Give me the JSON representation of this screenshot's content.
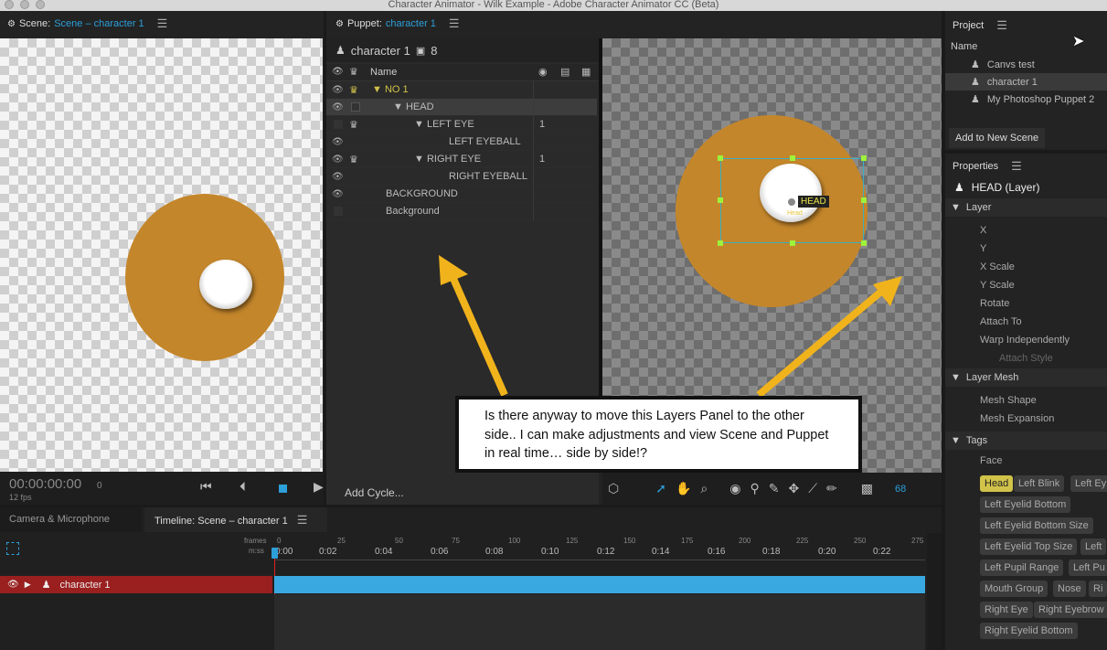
{
  "window_title": "Character Animator - Wilk Example - Adobe Character Animator CC (Beta)",
  "scene_panel": {
    "label": "Scene:",
    "name": "Scene – character 1",
    "timecode": "00:00:00:00",
    "frame": "0",
    "fps": "12 fps"
  },
  "puppet_panel": {
    "label": "Puppet:",
    "name": "character 1",
    "puppet_name": "character 1",
    "count": "8",
    "col_name": "Name",
    "add_cycle": "Add Cycle...",
    "zoom": "68"
  },
  "layers": [
    {
      "name": "NO 1",
      "num": ""
    },
    {
      "name": "HEAD",
      "num": ""
    },
    {
      "name": "LEFT EYE",
      "num": "1"
    },
    {
      "name": "LEFT EYEBALL",
      "num": ""
    },
    {
      "name": "RIGHT EYE",
      "num": "1"
    },
    {
      "name": "RIGHT EYEBALL",
      "num": ""
    },
    {
      "name": "BACKGROUND",
      "num": ""
    },
    {
      "name": "Background",
      "num": ""
    }
  ],
  "canvas_labels": {
    "head_handle": "HEAD",
    "head_small": "Head"
  },
  "callout": "Is there anyway to move this Layers Panel to the other side.. I can make adjustments and view Scene and Puppet in real time… side by side!?",
  "project": {
    "title": "Project",
    "col_name": "Name",
    "items": [
      "Canvs test",
      "character 1",
      "My Photoshop Puppet 2"
    ],
    "add_button": "Add to New Scene"
  },
  "properties": {
    "title": "Properties",
    "selected": "HEAD (Layer)",
    "layer_section": "Layer",
    "layer_props": [
      "X",
      "Y",
      "X Scale",
      "Y Scale",
      "Rotate",
      "Attach To",
      "Warp Independently"
    ],
    "attach_style": "Attach Style",
    "mesh_section": "Layer Mesh",
    "mesh_props": [
      "Mesh Shape",
      "Mesh Expansion"
    ],
    "tags_section": "Tags",
    "face": "Face",
    "tags": [
      "Head",
      "Left Blink",
      "Left Ey",
      "Left Eyelid Bottom",
      "Left Eyelid Bottom Size",
      "Left Eyelid Top Size",
      "Left",
      "Left Pupil Range",
      "Left Pu",
      "Mouth Group",
      "Nose",
      "Ri",
      "Right Eye",
      "Right Eyebrow",
      "Right Eyelid Bottom"
    ]
  },
  "timeline": {
    "tab_camera": "Camera & Microphone",
    "tab_timeline": "Timeline: Scene – character 1",
    "frames_label": "frames",
    "mss_label": "m:ss",
    "frame_ticks": [
      "0",
      "25",
      "50",
      "75",
      "100",
      "125",
      "150",
      "175",
      "200",
      "225",
      "250",
      "275"
    ],
    "time_ticks": [
      "0:00",
      "0:02",
      "0:04",
      "0:06",
      "0:08",
      "0:10",
      "0:12",
      "0:14",
      "0:16",
      "0:18",
      "0:20",
      "0:22"
    ],
    "track_name": "character 1"
  },
  "colors": {
    "accent": "#2d9fd9",
    "head_fill": "#c4862b",
    "track_bar": "#3aa8e0",
    "track_row": "#9a1f1f",
    "arrow": "#f1b31c",
    "tag_on": "#d1c24a"
  }
}
